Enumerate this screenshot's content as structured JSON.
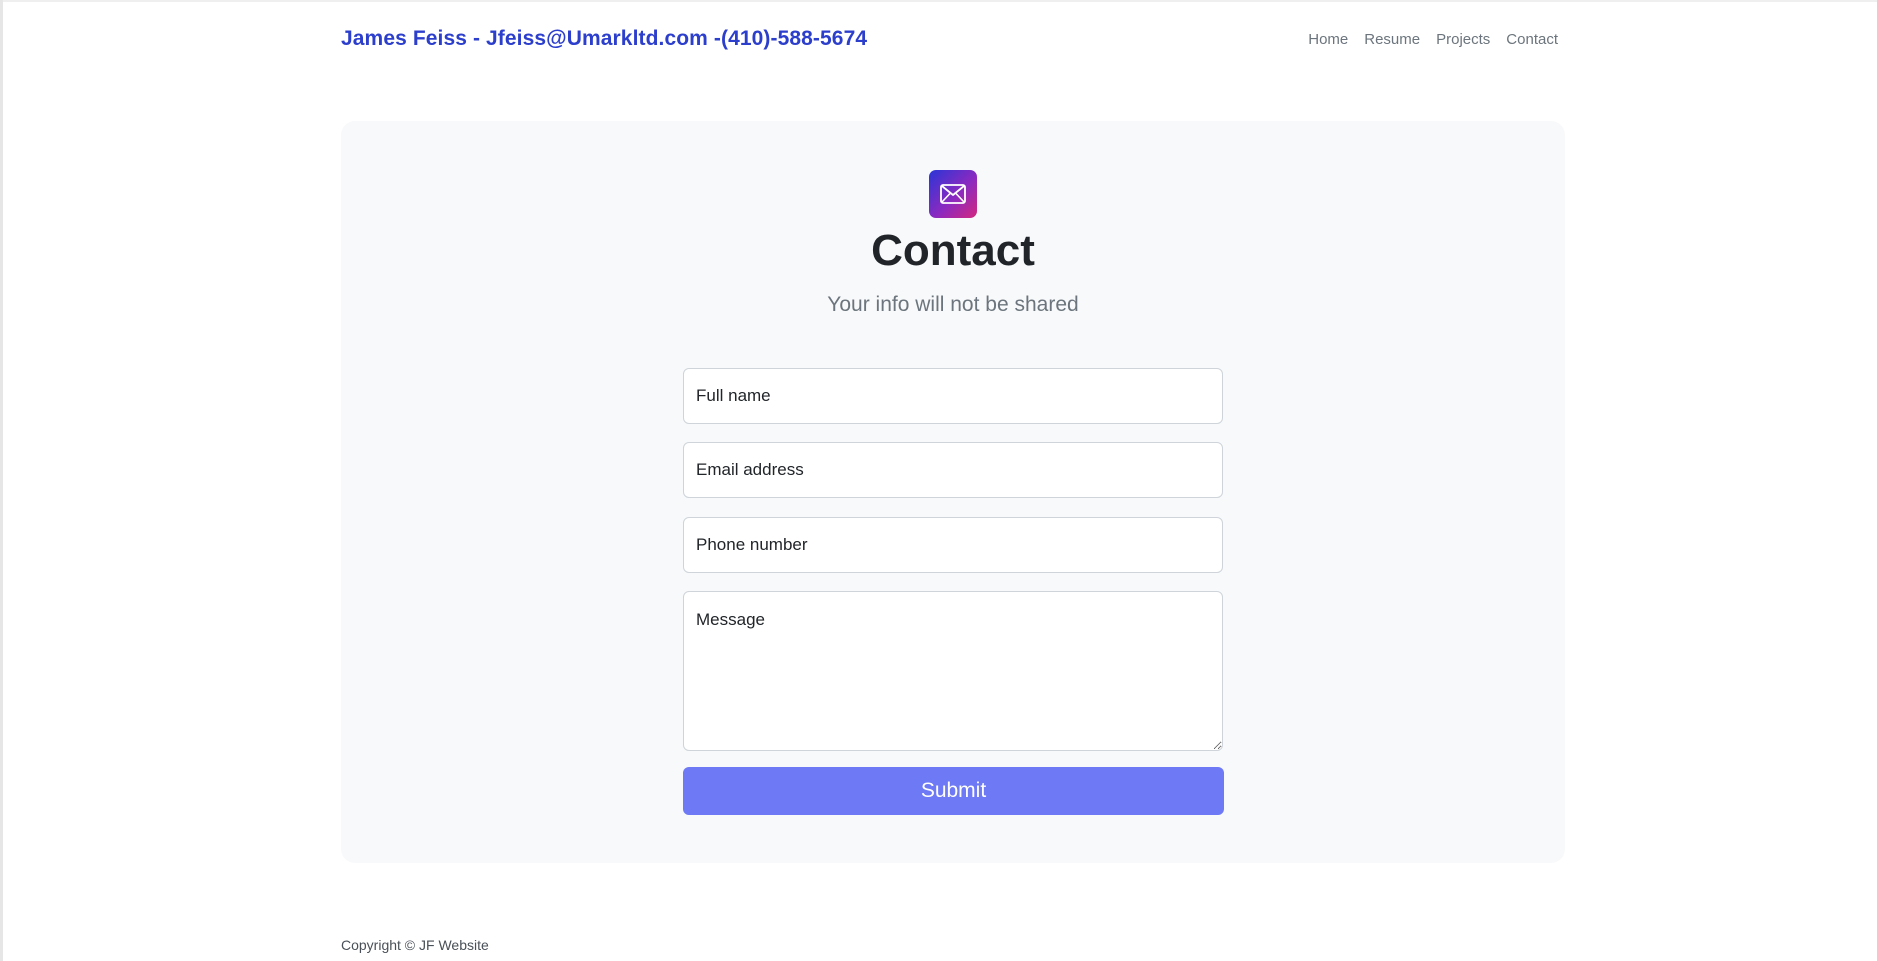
{
  "header": {
    "brand": "James Feiss - Jfeiss@Umarkltd.com -(410)-588-5674",
    "nav": [
      {
        "label": "Home"
      },
      {
        "label": "Resume"
      },
      {
        "label": "Projects"
      },
      {
        "label": "Contact"
      }
    ]
  },
  "contact": {
    "icon": "envelope-icon",
    "title": "Contact",
    "subtitle": "Your info will not be shared",
    "form": {
      "full_name_placeholder": "Full name",
      "email_placeholder": "Email address",
      "phone_placeholder": "Phone number",
      "message_placeholder": "Message",
      "submit_label": "Submit"
    }
  },
  "footer": {
    "copyright": "Copyright © JF Website"
  },
  "colors": {
    "brand_blue": "#2c3ecc",
    "submit_button": "#6d79f5",
    "card_background": "#f8f9fa",
    "icon_gradient_start": "#2b35d6",
    "icon_gradient_end": "#d3277e"
  }
}
